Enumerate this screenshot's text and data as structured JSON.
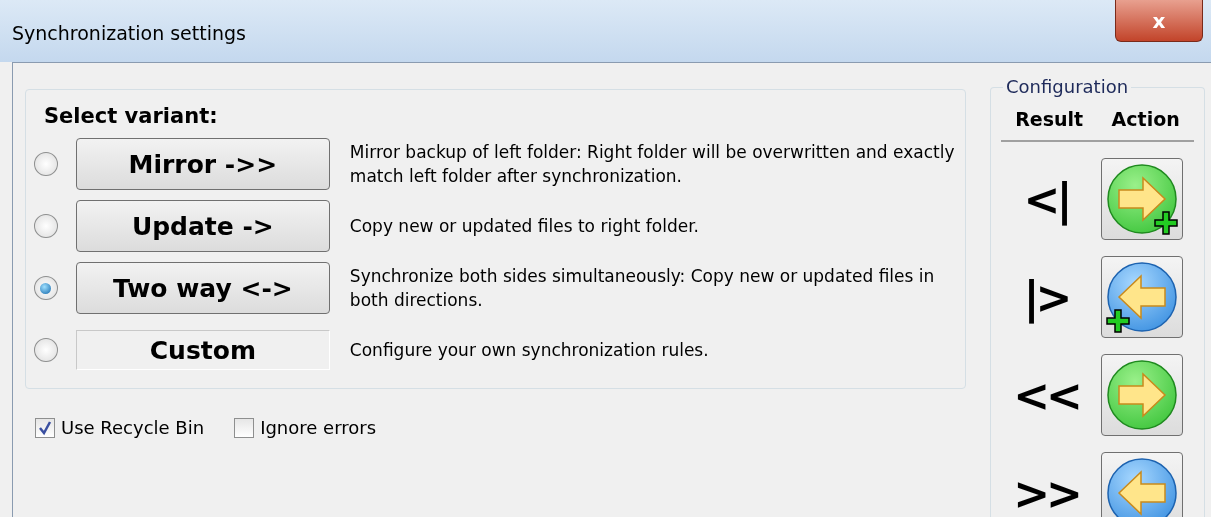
{
  "window": {
    "title": "Synchronization settings",
    "close_label": "x"
  },
  "variants": {
    "heading": "Select variant:",
    "items": [
      {
        "kind": "button",
        "label": "Mirror ->>",
        "description": "Mirror backup of left folder: Right folder will be overwritten and exactly match left folder after synchronization.",
        "selected": false
      },
      {
        "kind": "button",
        "label": "Update ->",
        "description": "Copy new or updated files to right folder.",
        "selected": false
      },
      {
        "kind": "button",
        "label": "Two way <->",
        "description": "Synchronize both sides simultaneously: Copy new or updated files in both directions.",
        "selected": true
      },
      {
        "kind": "label",
        "label": "Custom",
        "description": "Configure your own synchronization rules.",
        "selected": false
      }
    ]
  },
  "options": [
    {
      "label": "Use Recycle Bin",
      "checked": true
    },
    {
      "label": "Ignore errors",
      "checked": false
    }
  ],
  "configuration": {
    "title": "Configuration",
    "columns": [
      "Result",
      "Action"
    ],
    "rows": [
      {
        "result": "<|",
        "action": {
          "kind": "right",
          "plus": true
        }
      },
      {
        "result": "|>",
        "action": {
          "kind": "left",
          "plus": true
        }
      },
      {
        "result": "<<",
        "action": {
          "kind": "right",
          "plus": false
        }
      },
      {
        "result": ">>",
        "action": {
          "kind": "left",
          "plus": false
        }
      }
    ]
  }
}
